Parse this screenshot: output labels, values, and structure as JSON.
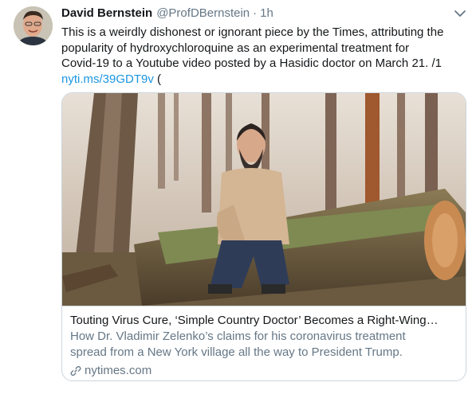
{
  "tweet": {
    "author_name": "David Bernstein",
    "author_handle": "@ProfDBernstein",
    "separator": "·",
    "timestamp": "1h",
    "text_lines": [
      "This is a weirdly dishonest or ignorant piece by the Times, attributing the",
      "popularity of hydroxychloroquine as an experimental treatment for",
      "Covid-19 to a Youtube video posted by a Hasidic doctor on March 21. /1"
    ],
    "link_text": "nyti.ms/39GDT9v",
    "link_suffix": " ("
  },
  "card": {
    "title": "Touting Virus Cure, ‘Simple Country Doctor’ Becomes a Right-Wing…",
    "description_lines": [
      "How Dr. Vladimir Zelenko’s claims for his coronavirus treatment",
      "spread from a New York village all the way to President Trump."
    ],
    "domain": "nytimes.com"
  },
  "icons": {
    "caret": "chevron-down-icon",
    "link": "link-icon"
  },
  "colors": {
    "link": "#1b95e0",
    "secondary_text": "#657786",
    "border": "#ccd6dd"
  }
}
